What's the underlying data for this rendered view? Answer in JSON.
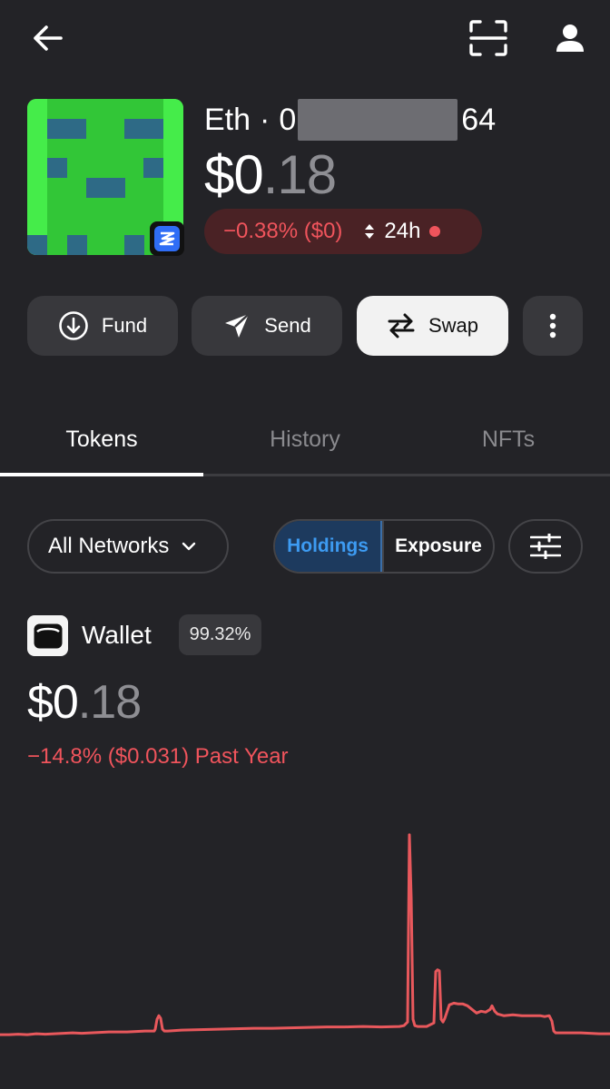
{
  "header": {
    "back_icon": "arrow-left-icon",
    "scan_icon": "scan-icon",
    "profile_icon": "person-icon"
  },
  "account": {
    "network": "Eth",
    "separator": "·",
    "address_prefix": "0",
    "address_suffix": "64",
    "balance_whole": "$0",
    "balance_decimal": ".18",
    "change_text": "−0.38% ($0)",
    "period_label": "24h",
    "badge_icon": "zerion-icon"
  },
  "actions": [
    {
      "label": "Fund",
      "icon": "arrow-down-circle-icon"
    },
    {
      "label": "Send",
      "icon": "send-icon"
    },
    {
      "label": "Swap",
      "icon": "swap-icon"
    },
    {
      "label": "",
      "icon": "more-vertical-icon"
    }
  ],
  "tabs": [
    {
      "label": "Tokens",
      "active": true
    },
    {
      "label": "History",
      "active": false
    },
    {
      "label": "NFTs",
      "active": false
    }
  ],
  "filters": {
    "network_label": "All Networks",
    "holdings_label": "Holdings",
    "exposure_label": "Exposure",
    "selected": "Holdings"
  },
  "wallet": {
    "label": "Wallet",
    "percent": "99.32%",
    "balance_whole": "$0",
    "balance_decimal": ".18",
    "change_text": "−14.8% ($0.031) Past Year"
  },
  "colors": {
    "background": "#232327",
    "negative": "#f0545c",
    "accent_blue": "#3d9bf2"
  },
  "chart_data": {
    "type": "line",
    "color": "#e8585c",
    "x": [
      0,
      10,
      20,
      30,
      40,
      50,
      60,
      70,
      80,
      90,
      100,
      110,
      120,
      130,
      140,
      150,
      160,
      170,
      171,
      173,
      175,
      177,
      179,
      181,
      185,
      200,
      220,
      240,
      260,
      280,
      300,
      320,
      340,
      360,
      380,
      400,
      420,
      440,
      445,
      447,
      449,
      451,
      453,
      455,
      457,
      460,
      470,
      478,
      480,
      482,
      484,
      486,
      488,
      490,
      495,
      500,
      505,
      510,
      515,
      520,
      525,
      530,
      535,
      540,
      542,
      545,
      548,
      555,
      565,
      575,
      585,
      595,
      600,
      605,
      608,
      610,
      612,
      614,
      620,
      640,
      660,
      672
    ],
    "values": [
      8,
      8,
      8.5,
      8,
      9,
      8.5,
      9,
      9.5,
      10,
      9.5,
      10,
      10.5,
      11,
      11,
      11,
      11.5,
      12,
      12,
      14,
      25,
      29,
      26,
      14,
      12,
      12,
      13,
      13.5,
      14,
      14.5,
      15,
      15,
      15.5,
      16,
      16.5,
      16.5,
      17,
      16.5,
      17,
      18,
      20,
      22,
      230,
      160,
      25,
      18,
      17,
      17,
      21,
      78,
      80,
      79,
      25,
      22,
      26,
      41,
      43,
      42,
      42,
      40,
      36,
      32,
      34,
      33,
      36,
      40,
      34,
      31,
      29,
      30,
      29,
      29,
      29,
      28,
      29,
      23,
      12,
      10,
      10,
      10,
      10,
      9,
      9
    ],
    "ylim": [
      0,
      240
    ],
    "grid": false,
    "title": "",
    "xlabel": "",
    "ylabel": ""
  }
}
